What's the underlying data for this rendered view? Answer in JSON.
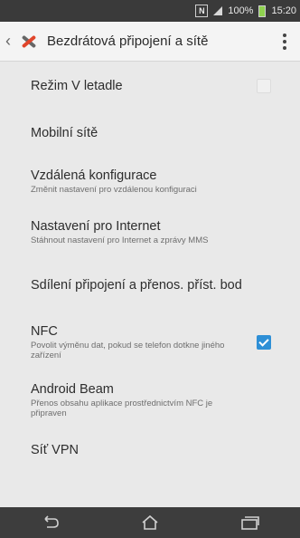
{
  "status_bar": {
    "nfc_icon": "N",
    "signal_text": "100%",
    "battery_text": "",
    "time": "15:20"
  },
  "action_bar": {
    "title": "Bezdrátová připojení a sítě",
    "icon": "tools-icon",
    "accent_color": "#e0452b"
  },
  "settings": [
    {
      "title": "Režim V letadle",
      "subtitle": "",
      "checkbox": "off"
    },
    {
      "title": "Mobilní sítě",
      "subtitle": "",
      "checkbox": "none"
    },
    {
      "title": "Vzdálená konfigurace",
      "subtitle": "Změnit nastavení pro vzdálenou konfiguraci",
      "checkbox": "none"
    },
    {
      "title": "Nastavení pro Internet",
      "subtitle": "Stáhnout nastavení pro Internet a zprávy MMS",
      "checkbox": "none"
    },
    {
      "title": "Sdílení připojení a přenos. příst. bod",
      "subtitle": "",
      "checkbox": "none"
    },
    {
      "title": "NFC",
      "subtitle": "Povolit výměnu dat, pokud se telefon dotkne jiného zařízení",
      "checkbox": "on"
    },
    {
      "title": "Android Beam",
      "subtitle": "Přenos obsahu aplikace prostřednictvím NFC je připraven",
      "checkbox": "none"
    },
    {
      "title": "Síť VPN",
      "subtitle": "",
      "checkbox": "none"
    }
  ],
  "checkbox_color": "#2e8fd6"
}
